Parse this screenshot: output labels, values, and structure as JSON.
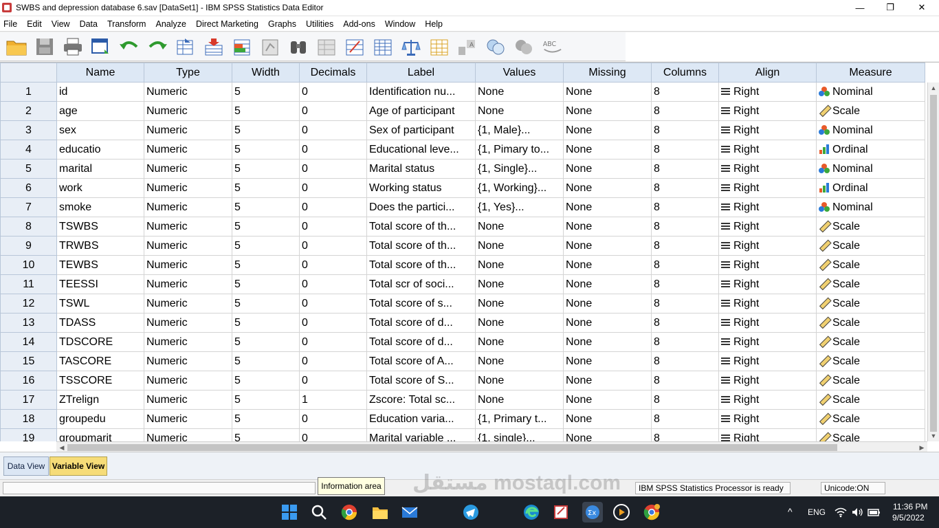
{
  "window": {
    "title": "SWBS and depression database 6.sav [DataSet1] - IBM SPSS Statistics Data Editor",
    "min": "—",
    "max": "❐",
    "close": "✕"
  },
  "menu": [
    "File",
    "Edit",
    "View",
    "Data",
    "Transform",
    "Analyze",
    "Direct Marketing",
    "Graphs",
    "Utilities",
    "Add-ons",
    "Window",
    "Help"
  ],
  "columns": [
    "Name",
    "Type",
    "Width",
    "Decimals",
    "Label",
    "Values",
    "Missing",
    "Columns",
    "Align",
    "Measure"
  ],
  "rows": [
    [
      "1",
      "id",
      "Numeric",
      "5",
      "0",
      "Identification nu...",
      "None",
      "None",
      "8",
      "Right",
      "Nominal"
    ],
    [
      "2",
      "age",
      "Numeric",
      "5",
      "0",
      "Age of participant",
      "None",
      "None",
      "8",
      "Right",
      "Scale"
    ],
    [
      "3",
      "sex",
      "Numeric",
      "5",
      "0",
      "Sex of participant",
      "{1, Male}...",
      "None",
      "8",
      "Right",
      "Nominal"
    ],
    [
      "4",
      "educatio",
      "Numeric",
      "5",
      "0",
      "Educational leve...",
      "{1, Pimary to...",
      "None",
      "8",
      "Right",
      "Ordinal"
    ],
    [
      "5",
      "marital",
      "Numeric",
      "5",
      "0",
      "Marital status",
      "{1, Single}...",
      "None",
      "8",
      "Right",
      "Nominal"
    ],
    [
      "6",
      "work",
      "Numeric",
      "5",
      "0",
      "Working status",
      "{1, Working}...",
      "None",
      "8",
      "Right",
      "Ordinal"
    ],
    [
      "7",
      "smoke",
      "Numeric",
      "5",
      "0",
      "Does the partici...",
      "{1, Yes}...",
      "None",
      "8",
      "Right",
      "Nominal"
    ],
    [
      "8",
      "TSWBS",
      "Numeric",
      "5",
      "0",
      "Total score of th...",
      "None",
      "None",
      "8",
      "Right",
      "Scale"
    ],
    [
      "9",
      "TRWBS",
      "Numeric",
      "5",
      "0",
      "Total score of th...",
      "None",
      "None",
      "8",
      "Right",
      "Scale"
    ],
    [
      "10",
      "TEWBS",
      "Numeric",
      "5",
      "0",
      "Total score of th...",
      "None",
      "None",
      "8",
      "Right",
      "Scale"
    ],
    [
      "11",
      "TEESSI",
      "Numeric",
      "5",
      "0",
      "Total scr of soci...",
      "None",
      "None",
      "8",
      "Right",
      "Scale"
    ],
    [
      "12",
      "TSWL",
      "Numeric",
      "5",
      "0",
      "Total score of s...",
      "None",
      "None",
      "8",
      "Right",
      "Scale"
    ],
    [
      "13",
      "TDASS",
      "Numeric",
      "5",
      "0",
      "Total score of d...",
      "None",
      "None",
      "8",
      "Right",
      "Scale"
    ],
    [
      "14",
      "TDSCORE",
      "Numeric",
      "5",
      "0",
      "Total score of d...",
      "None",
      "None",
      "8",
      "Right",
      "Scale"
    ],
    [
      "15",
      "TASCORE",
      "Numeric",
      "5",
      "0",
      "Total score of A...",
      "None",
      "None",
      "8",
      "Right",
      "Scale"
    ],
    [
      "16",
      "TSSCORE",
      "Numeric",
      "5",
      "0",
      "Total score of S...",
      "None",
      "None",
      "8",
      "Right",
      "Scale"
    ],
    [
      "17",
      "ZTrelign",
      "Numeric",
      "5",
      "1",
      "Zscore: Total sc...",
      "None",
      "None",
      "8",
      "Right",
      "Scale"
    ],
    [
      "18",
      "groupedu",
      "Numeric",
      "5",
      "0",
      "Education varia...",
      "{1, Primary t...",
      "None",
      "8",
      "Right",
      "Scale"
    ],
    [
      "19",
      "groupmarit",
      "Numeric",
      "5",
      "0",
      "Marital variable ...",
      "{1, single}...",
      "None",
      "8",
      "Right",
      "Scale"
    ]
  ],
  "tabs": {
    "data_view": "Data View",
    "variable_view": "Variable View"
  },
  "status": {
    "info_area": "Information area",
    "processor": "IBM SPSS Statistics Processor is ready",
    "unicode": "Unicode:ON"
  },
  "taskbar": {
    "lang": "ENG",
    "time": "11:36 PM",
    "date": "9/5/2022",
    "chevron": "^"
  },
  "watermark": "مستقل mostaql.com"
}
